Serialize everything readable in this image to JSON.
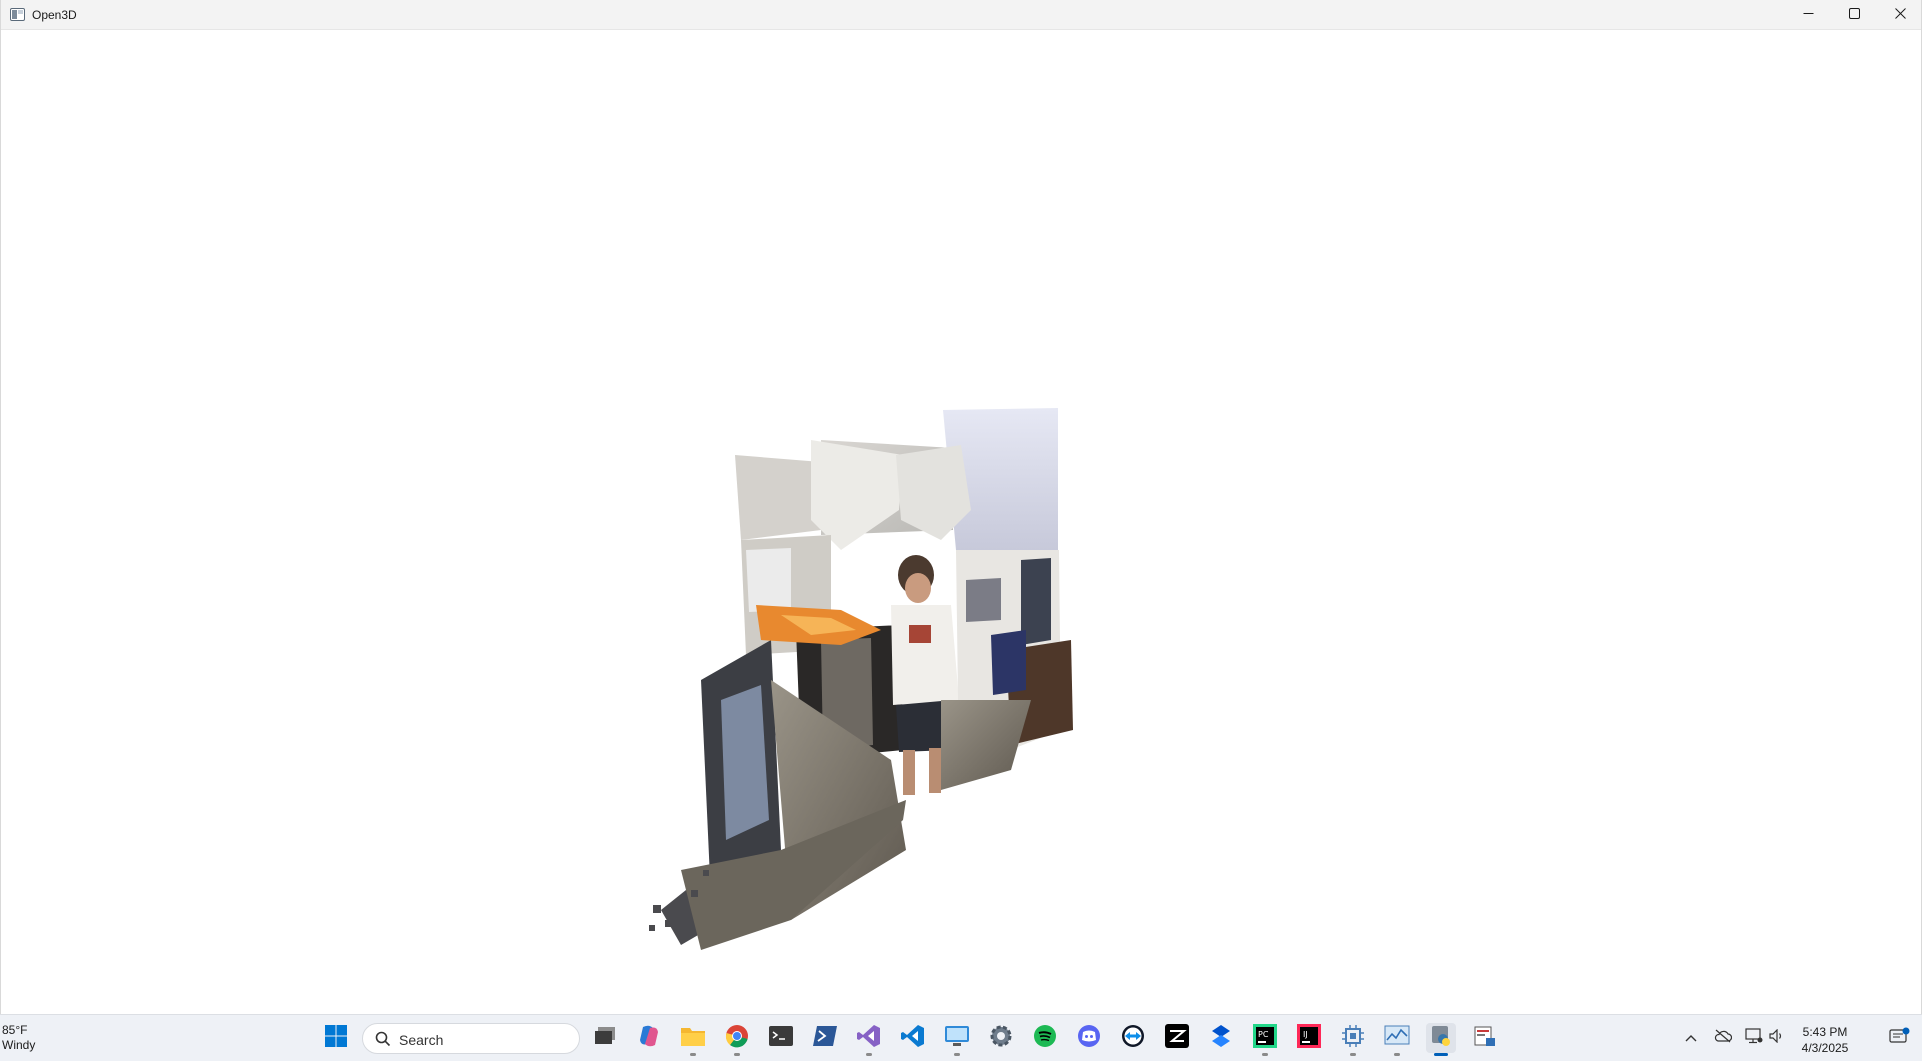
{
  "window": {
    "title": "Open3D",
    "controls": {
      "minimize": "minimize-icon",
      "maximize": "maximize-icon",
      "close": "close-icon"
    }
  },
  "viewport": {
    "content": "point-cloud-render"
  },
  "taskbar": {
    "weather": {
      "temperature": "85°F",
      "condition": "Windy"
    },
    "search": {
      "label": "Search"
    },
    "apps": [
      "start-icon",
      "task-view-icon",
      "copilot-icon",
      "file-explorer-icon",
      "chrome-icon",
      "terminal-icon",
      "powershell-icon",
      "visual-studio-icon",
      "vscode-icon",
      "remote-desktop-icon",
      "settings-icon",
      "spotify-icon",
      "discord-icon",
      "teamviewer-icon",
      "capcut-icon",
      "sourcetree-icon",
      "pycharm-icon",
      "intellij-icon",
      "chip-tool-icon",
      "resource-monitor-icon",
      "python-icon",
      "open3d-app-icon"
    ],
    "tray": {
      "overflow": "chevron-up-icon",
      "icons": [
        "cloud-offline-icon",
        "network-icon",
        "speaker-icon"
      ],
      "time": "5:43 PM",
      "date": "4/3/2025",
      "notifications": "notification-icon"
    }
  },
  "colors": {
    "taskbar_bg": "#eef1f6",
    "accent": "#005fb8",
    "titlebar_bg": "#f3f3f3"
  }
}
